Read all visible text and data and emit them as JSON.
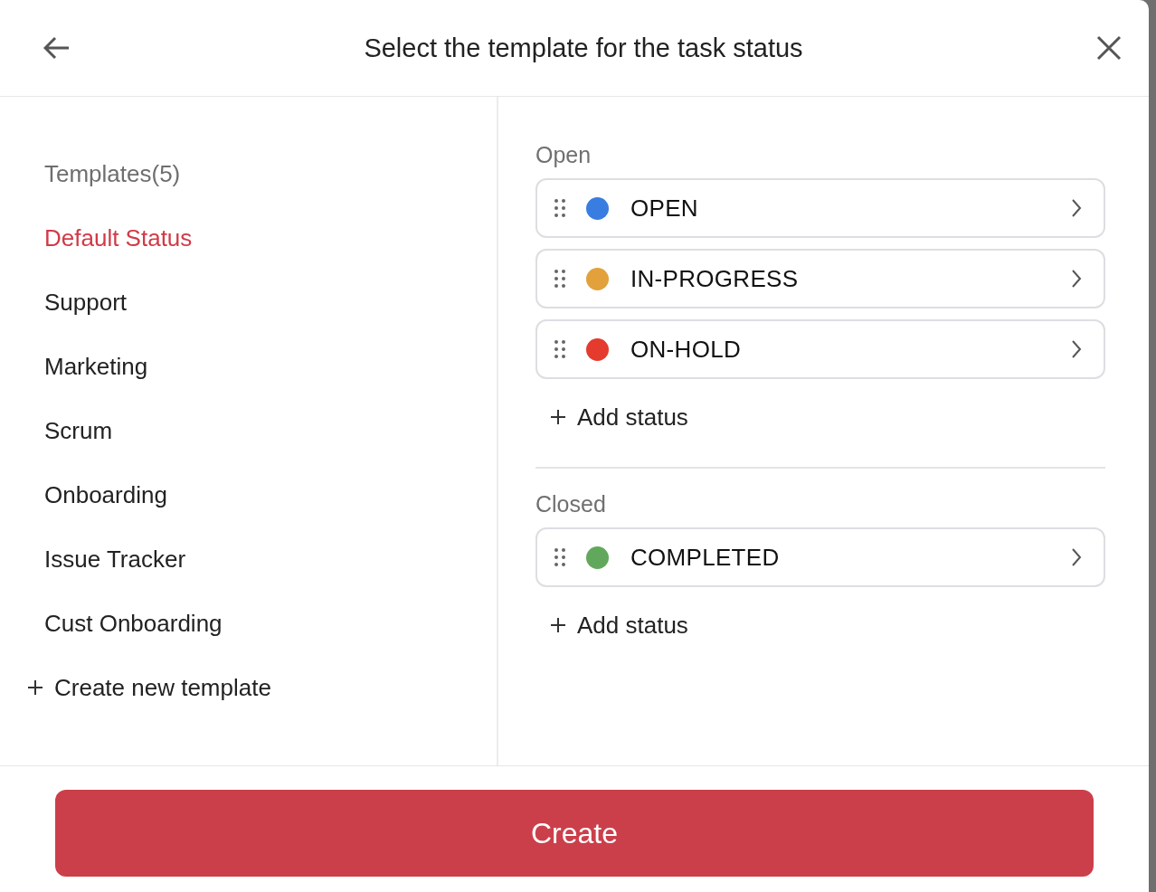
{
  "dialog": {
    "title": "Select the template for the task status"
  },
  "sidebar": {
    "heading": "Templates(5)",
    "items": [
      {
        "label": "Default Status",
        "selected": true
      },
      {
        "label": "Support",
        "selected": false
      },
      {
        "label": "Marketing",
        "selected": false
      },
      {
        "label": "Scrum",
        "selected": false
      },
      {
        "label": "Onboarding",
        "selected": false
      },
      {
        "label": "Issue Tracker",
        "selected": false
      },
      {
        "label": "Cust Onboarding",
        "selected": false
      }
    ],
    "create_label": "Create new template"
  },
  "groups": [
    {
      "label": "Open",
      "statuses": [
        {
          "name": "OPEN",
          "color": "#3a7de0"
        },
        {
          "name": "IN-PROGRESS",
          "color": "#e2a13a"
        },
        {
          "name": "ON-HOLD",
          "color": "#e53a2e"
        }
      ],
      "add_label": "Add status"
    },
    {
      "label": "Closed",
      "statuses": [
        {
          "name": "COMPLETED",
          "color": "#62a85c"
        }
      ],
      "add_label": "Add status"
    }
  ],
  "footer": {
    "button": "Create"
  }
}
